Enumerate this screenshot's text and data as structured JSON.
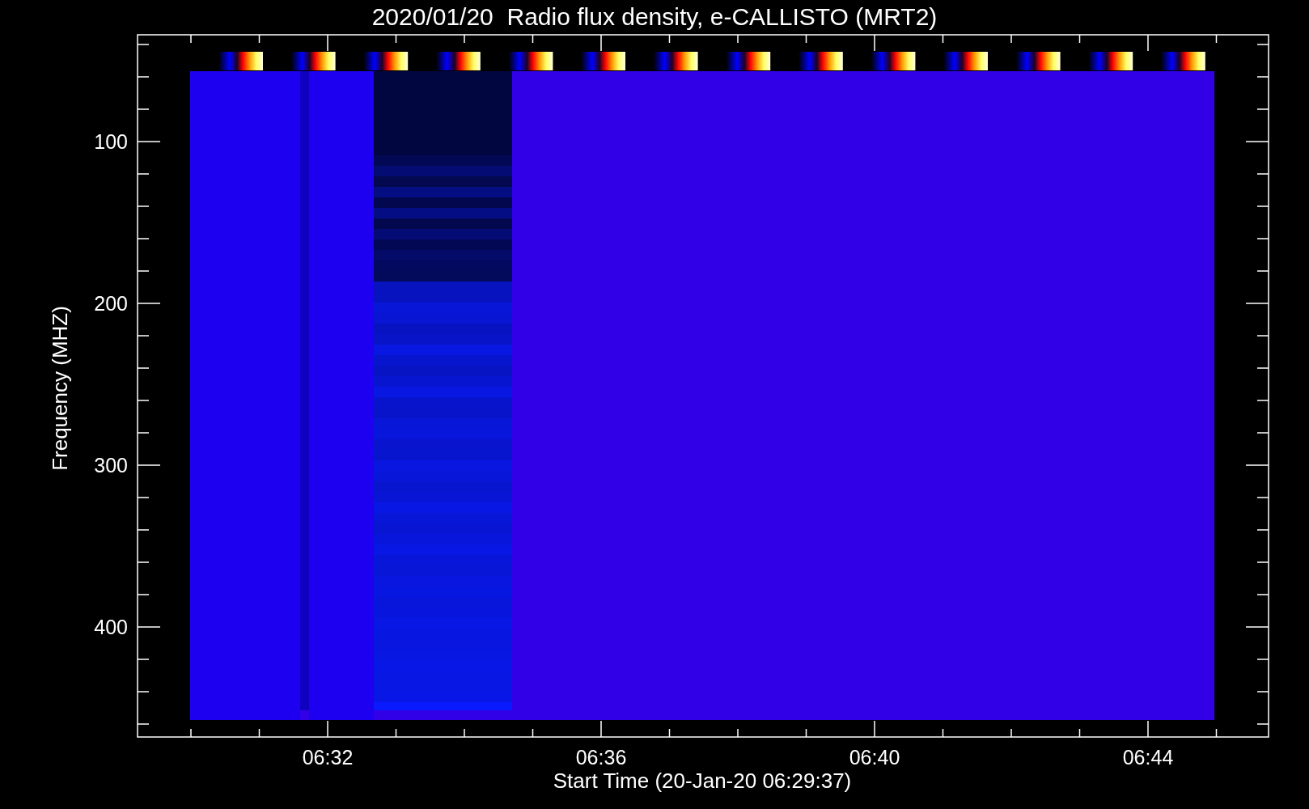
{
  "title": "2020/01/20  Radio flux density, e-CALLISTO (MRT2)",
  "x_axis": {
    "label": "Start Time (20-Jan-20 06:29:37)",
    "ticks": [
      "06:32",
      "06:36",
      "06:40",
      "06:44"
    ]
  },
  "y_axis": {
    "label": "Frequency (MHZ)",
    "ticks": [
      "100",
      "200",
      "300",
      "400"
    ]
  }
}
